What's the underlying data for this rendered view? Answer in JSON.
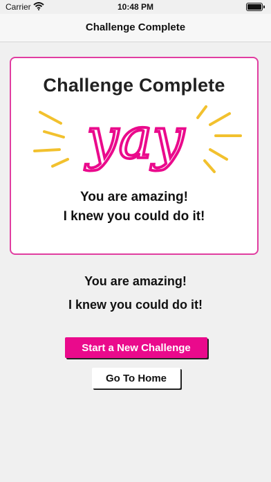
{
  "status_bar": {
    "carrier": "Carrier",
    "time": "10:48 PM",
    "icons": [
      "wifi-icon",
      "battery-icon"
    ]
  },
  "nav": {
    "title": "Challenge Complete"
  },
  "card": {
    "heading": "Challenge Complete",
    "art_word": "yay",
    "line1": "You are amazing!",
    "line2": "I knew you could do it!",
    "colors": {
      "border": "#e03ca0",
      "art": "#ea0a8c",
      "rays": "#f2c12e"
    }
  },
  "message": {
    "line1": "You are amazing!",
    "line2": "I knew you could do it!"
  },
  "actions": {
    "new_challenge_label": "Start a New Challenge",
    "home_label": "Go To Home"
  },
  "colors": {
    "accent": "#ea0a8c",
    "background": "#f0f0f0"
  }
}
